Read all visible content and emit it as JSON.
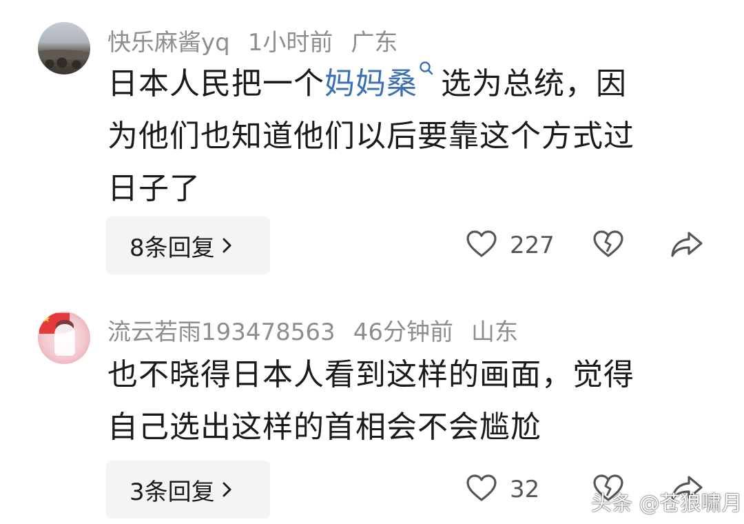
{
  "comments": [
    {
      "username": "快乐麻酱yq",
      "time": "1小时前",
      "location": "广东",
      "text_lines": [
        {
          "before": "日本人民把一个",
          "link": "妈妈桑",
          "after": "选为总统，因"
        },
        {
          "text": "为他们也知道他们以后要靠这个方式过"
        },
        {
          "text": "日子了"
        }
      ],
      "reply_label": "8条回复",
      "likes": "227",
      "icons": [
        "heart-icon",
        "broken-heart-icon",
        "share-arrow-icon",
        "chevron-right-icon",
        "search-icon"
      ]
    },
    {
      "username": "流云若雨193478563",
      "time": "46分钟前",
      "location": "山东",
      "text_lines": [
        {
          "text": "也不晓得日本人看到这样的画面，觉得"
        },
        {
          "text": "自己选出这样的首相会不会尴尬"
        }
      ],
      "reply_label": "3条回复",
      "likes": "32",
      "icons": [
        "heart-icon",
        "broken-heart-icon",
        "share-arrow-icon",
        "chevron-right-icon"
      ]
    }
  ],
  "watermark": "头条 @苍狼啸月",
  "colors": {
    "link": "#3b6fb6",
    "meta": "#8d8d8d",
    "reply_bg": "#f4f4f4",
    "text": "#1a1a1a"
  }
}
